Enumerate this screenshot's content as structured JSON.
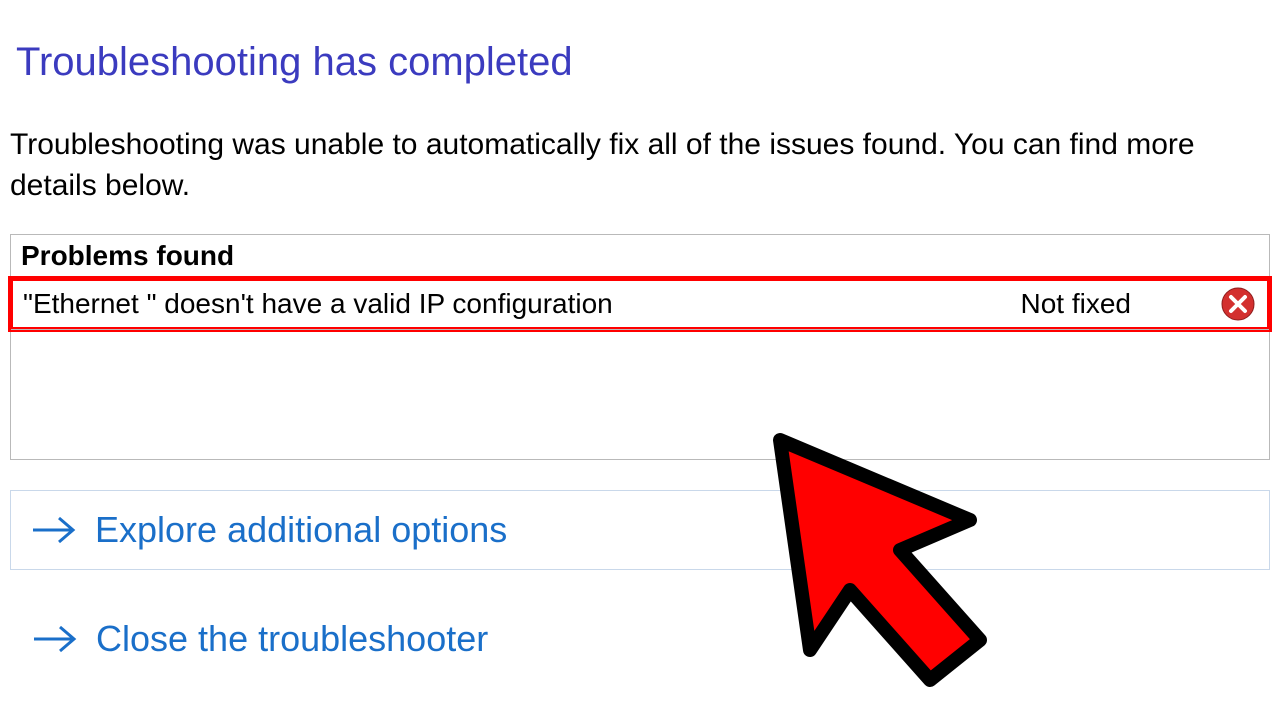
{
  "heading": "Troubleshooting has completed",
  "description": "Troubleshooting was unable to automatically fix all of the issues found. You can find more details below.",
  "problems": {
    "header": "Problems found",
    "items": [
      {
        "description": "\"Ethernet \" doesn't have a valid IP configuration",
        "status": "Not fixed",
        "icon": "error-x-icon"
      }
    ]
  },
  "options": [
    {
      "label": "Explore additional options"
    },
    {
      "label": "Close the troubleshooter"
    }
  ],
  "colors": {
    "headingBlue": "#3b3bbf",
    "linkBlue": "#1a6fc9",
    "errorRed": "#d3302f",
    "highlightRed": "#ff0000"
  }
}
